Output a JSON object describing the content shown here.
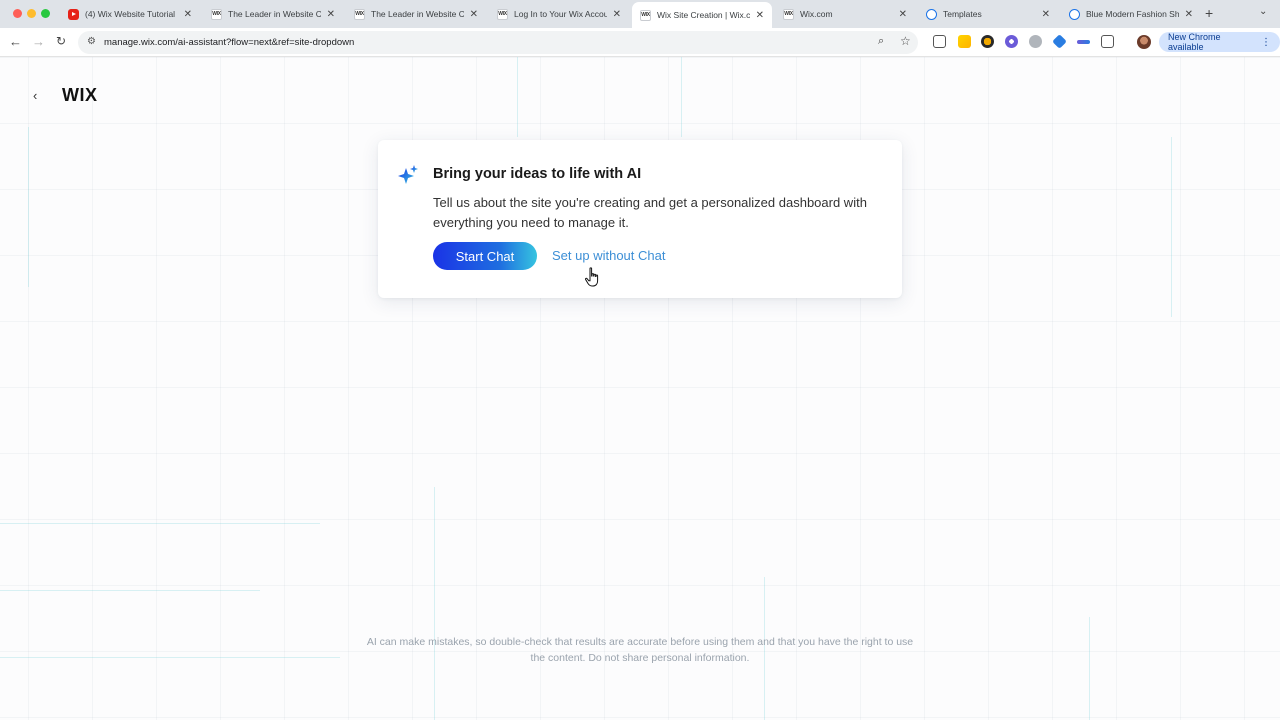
{
  "browser": {
    "tabs": [
      {
        "title": "(4) Wix Website Tutorial",
        "icon": "youtube-icon"
      },
      {
        "title": "The Leader in Website Cr",
        "icon": "wix-icon"
      },
      {
        "title": "The Leader in Website Cr",
        "icon": "wix-icon"
      },
      {
        "title": "Log In to Your Wix Accou",
        "icon": "wix-icon"
      },
      {
        "title": "Wix Site Creation | Wix.cc",
        "icon": "wix-icon",
        "active": true
      },
      {
        "title": "Wix.com",
        "icon": "wix-icon"
      },
      {
        "title": "Templates",
        "icon": "globe-icon"
      },
      {
        "title": "Blue Modern Fashion Sh",
        "icon": "globe-icon"
      }
    ],
    "favicon_text": "WIX",
    "url": "manage.wix.com/ai-assistant?flow=next&ref=site-dropdown",
    "update_button": "New Chrome available"
  },
  "page": {
    "logo": "WIX",
    "card": {
      "title": "Bring your ideas to life with AI",
      "description": "Tell us about the site you're creating and get a personalized dashboard with everything you need to manage it.",
      "primary_button": "Start Chat",
      "secondary_link": "Set up without Chat"
    },
    "disclaimer": "AI can make mistakes, so double-check that results are accurate before using them and that you have the right to use the content. Do not share personal information."
  },
  "colors": {
    "button_gradient_start": "#1a33e6",
    "button_gradient_end": "#36c4e0",
    "link": "#3d8fd6"
  }
}
